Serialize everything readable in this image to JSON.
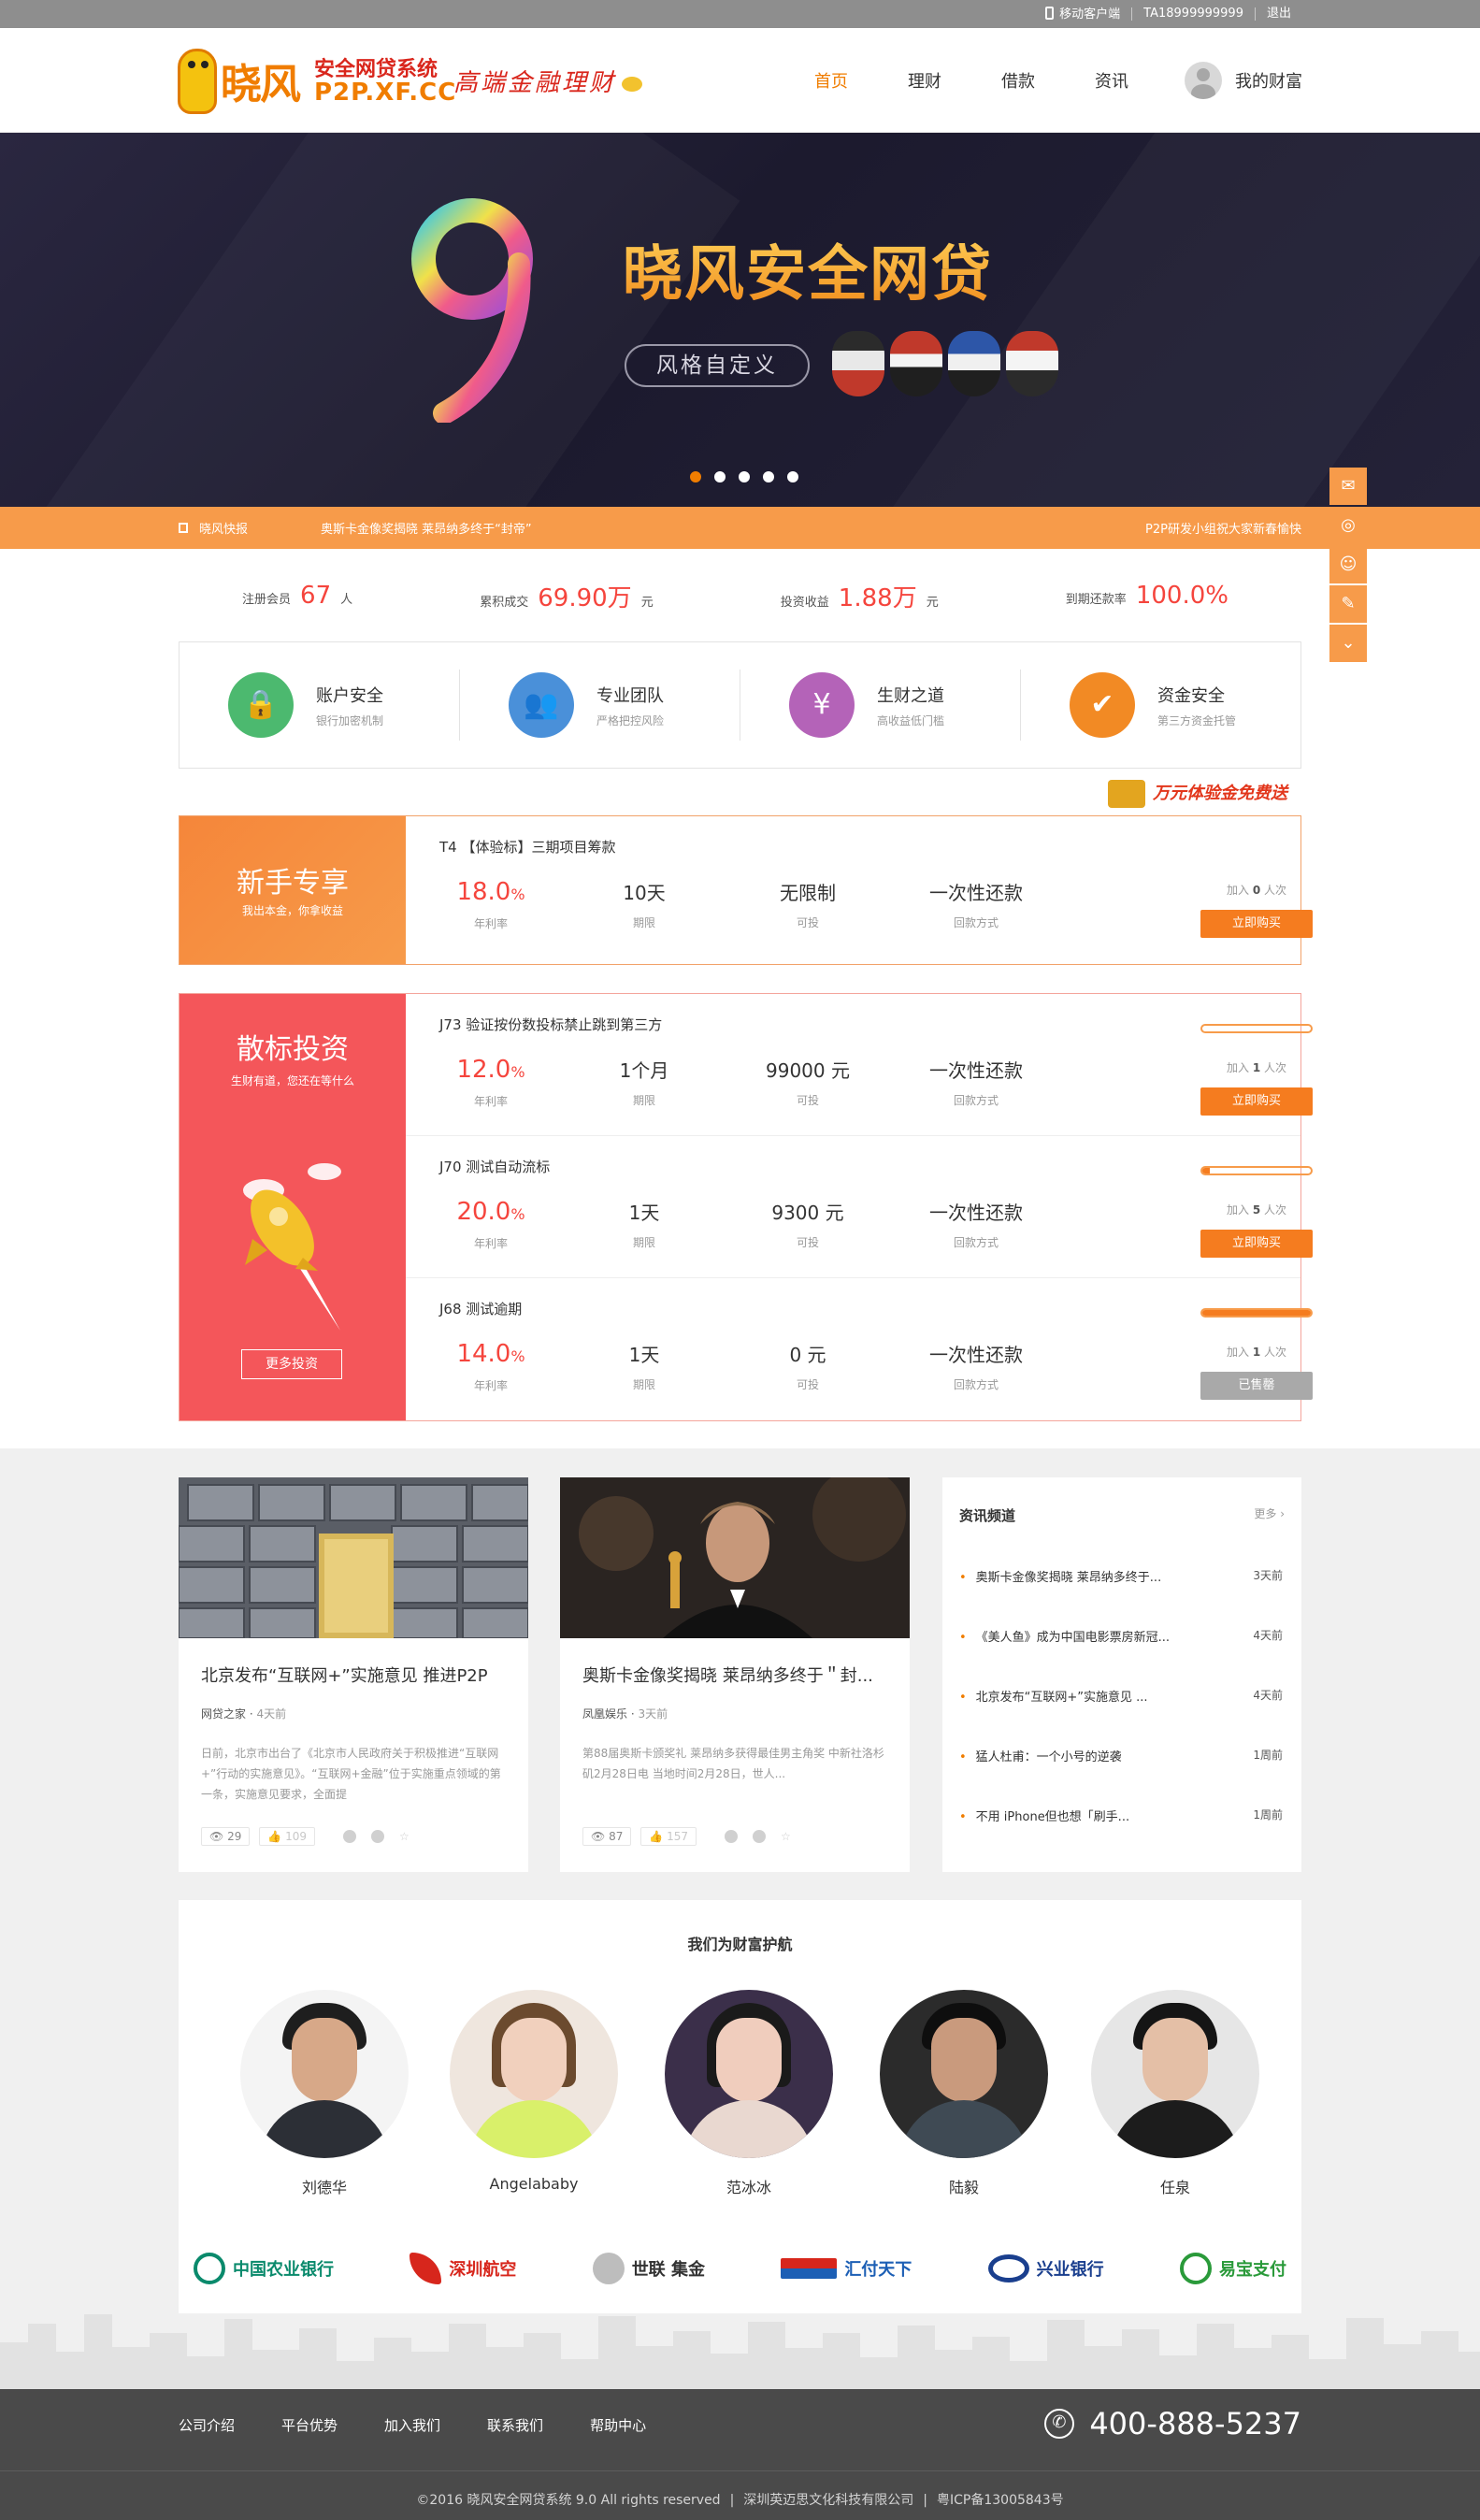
{
  "topbar": {
    "mobile": "移动客户端",
    "user": "TA18999999999",
    "logout": "退出"
  },
  "header": {
    "logo_main": "晓风",
    "logo_sub1": "安全网贷系统",
    "logo_sub2": "P2P.XF.CC",
    "slogan": "高端金融理财",
    "nav": [
      "首页",
      "理财",
      "借款",
      "资讯"
    ],
    "account": "我的财富"
  },
  "banner": {
    "title": "晓风安全网贷",
    "tag": "风格自定义",
    "slides": 5,
    "active_slide": 1
  },
  "ticker": {
    "label": "晓风快报",
    "text": "奥斯卡金像奖揭晓 莱昂纳多终于“封帝”",
    "right": "P2P研发小组祝大家新春愉快"
  },
  "stats": [
    {
      "label": "注册会员",
      "value": "67",
      "unit": "人"
    },
    {
      "label": "累积成交",
      "value": "69.90万",
      "unit": "元"
    },
    {
      "label": "投资收益",
      "value": "1.88万",
      "unit": "元"
    },
    {
      "label": "到期还款率",
      "value": "100.0%",
      "unit": ""
    }
  ],
  "features": [
    {
      "title": "账户安全",
      "sub": "银行加密机制",
      "icon": "lock-icon",
      "color": "#4cb96f"
    },
    {
      "title": "专业团队",
      "sub": "严格把控风险",
      "icon": "team-icon",
      "color": "#4a90d9"
    },
    {
      "title": "生财之道",
      "sub": "高收益低门槛",
      "icon": "money-bag-icon",
      "color": "#b463b8"
    },
    {
      "title": "资金安全",
      "sub": "第三方资金托管",
      "icon": "shield-icon",
      "color": "#f28a24"
    }
  ],
  "promo": "万元体验金免费送",
  "newbie": {
    "title": "新手专享",
    "sub": "我出本金，你拿收益",
    "item": {
      "code": "T4 【体验标】三期项目筹款",
      "rate": "18.0",
      "rate_unit": "%",
      "rate_label": "年利率",
      "term": "10天",
      "term_label": "期限",
      "amount": "无限制",
      "amount_label": "可投",
      "repay": "一次性还款",
      "repay_label": "回款方式",
      "join_prefix": "加入",
      "join_count": "0",
      "join_suffix": "人次",
      "button": "立即购买"
    }
  },
  "invest": {
    "title": "散标投资",
    "sub": "生财有道，您还在等什么",
    "more": "更多投资",
    "items": [
      {
        "code": "J73  验证按份数投标禁止跳到第三方",
        "rate": "12.0",
        "term": "1个月",
        "amount": "99000 元",
        "repay": "一次性还款",
        "join_count": "1",
        "button": "立即购买",
        "progress": 0.0,
        "sold": false
      },
      {
        "code": "J70  测试自动流标",
        "rate": "20.0",
        "term": "1天",
        "amount": "9300 元",
        "repay": "一次性还款",
        "join_count": "5",
        "button": "立即购买",
        "progress": 0.07,
        "sold": false
      },
      {
        "code": "J68  测试逾期",
        "rate": "14.0",
        "term": "1天",
        "amount": "0 元",
        "repay": "一次性还款",
        "join_count": "1",
        "button": "已售罄",
        "progress": 1.0,
        "sold": true
      }
    ],
    "labels": {
      "rate": "年利率",
      "term": "期限",
      "amount": "可投",
      "repay": "回款方式",
      "join_prefix": "加入",
      "join_suffix": "人次",
      "pct": "%"
    }
  },
  "news_cards": [
    {
      "title": "北京发布“互联网+”实施意见 推进P2P",
      "source": "网贷之家",
      "time": "4天前",
      "desc": "日前，北京市出台了《北京市人民政府关于积极推进“互联网+”行动的实施意见》。“互联网+金融”位于实施重点领域的第一条，实施意见要求，全面提",
      "views": "29",
      "likes": "109"
    },
    {
      "title": "奥斯卡金像奖揭晓 莱昂纳多终于＂封...",
      "source": "凤凰娱乐",
      "time": "3天前",
      "desc": "第88届奥斯卡颁奖礼 莱昂纳多获得最佳男主角奖 中新社洛杉矶2月28日电 当地时间2月28日，世人...",
      "views": "87",
      "likes": "157"
    }
  ],
  "news_channel": {
    "title": "资讯频道",
    "more": "更多 ›",
    "items": [
      {
        "t": "奥斯卡金像奖揭晓 莱昂纳多终于...",
        "d": "3天前"
      },
      {
        "t": "《美人鱼》成为中国电影票房新冠...",
        "d": "4天前"
      },
      {
        "t": "北京发布“互联网+”实施意见 ...",
        "d": "4天前"
      },
      {
        "t": "猛人杜甫：一个小号的逆袭",
        "d": "1周前"
      },
      {
        "t": "不用 iPhone但也想「刷手...",
        "d": "1周前"
      }
    ]
  },
  "stars": {
    "title": "我们为财富护航",
    "people": [
      "刘德华",
      "Angelababy",
      "范冰冰",
      "陆毅",
      "任泉"
    ]
  },
  "partners": [
    {
      "name": "中国农业银行",
      "color": "#0a8a6c"
    },
    {
      "name": "深圳航空",
      "color": "#d7261c"
    },
    {
      "name": "世联 集金",
      "color": "#333333"
    },
    {
      "name": "汇付天下",
      "color": "#1c5fb5"
    },
    {
      "name": "兴业银行",
      "color": "#1a3f8e"
    },
    {
      "name": "易宝支付",
      "color": "#2a9a3a"
    }
  ],
  "footer": {
    "links": [
      "公司介绍",
      "平台优势",
      "加入我们",
      "联系我们",
      "帮助中心"
    ],
    "tel": "400-888-5237",
    "copyright": "©2016 晓风安全网贷系统 9.0  All rights reserved",
    "company": "深圳英迈思文化科技有限公司",
    "icp": "粤ICP备13005843号"
  },
  "colors": {
    "accent": "#f07d00",
    "rate_red": "#f5453d",
    "ticker": "#f79b4a"
  }
}
